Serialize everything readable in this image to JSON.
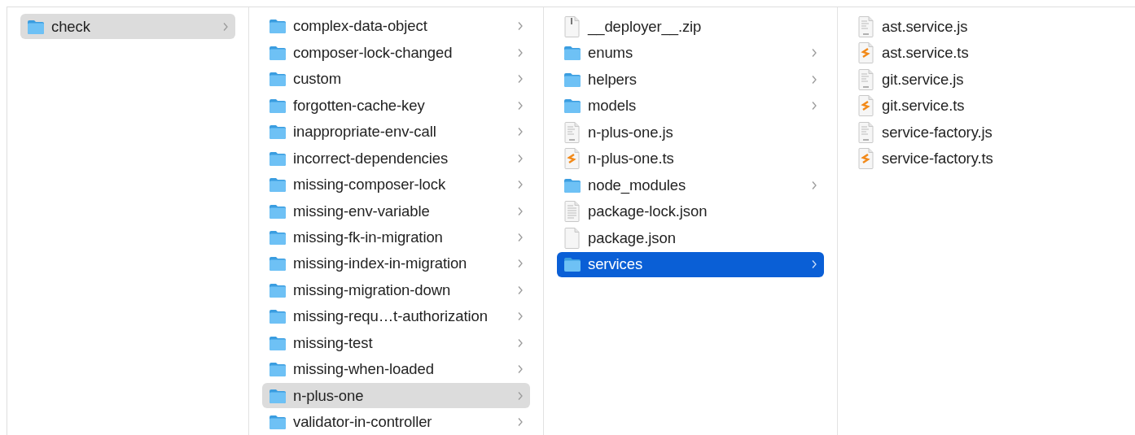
{
  "columns": [
    {
      "active": false,
      "items": [
        {
          "name": "check",
          "kind": "folder",
          "selected": true
        }
      ]
    },
    {
      "active": false,
      "items": [
        {
          "name": "complex-data-object",
          "kind": "folder",
          "selected": false
        },
        {
          "name": "composer-lock-changed",
          "kind": "folder",
          "selected": false
        },
        {
          "name": "custom",
          "kind": "folder",
          "selected": false
        },
        {
          "name": "forgotten-cache-key",
          "kind": "folder",
          "selected": false
        },
        {
          "name": "inappropriate-env-call",
          "kind": "folder",
          "selected": false
        },
        {
          "name": "incorrect-dependencies",
          "kind": "folder",
          "selected": false
        },
        {
          "name": "missing-composer-lock",
          "kind": "folder",
          "selected": false
        },
        {
          "name": "missing-env-variable",
          "kind": "folder",
          "selected": false
        },
        {
          "name": "missing-fk-in-migration",
          "kind": "folder",
          "selected": false
        },
        {
          "name": "missing-index-in-migration",
          "kind": "folder",
          "selected": false
        },
        {
          "name": "missing-migration-down",
          "kind": "folder",
          "selected": false
        },
        {
          "name": "missing-requ…t-authorization",
          "kind": "folder",
          "selected": false
        },
        {
          "name": "missing-test",
          "kind": "folder",
          "selected": false
        },
        {
          "name": "missing-when-loaded",
          "kind": "folder",
          "selected": false
        },
        {
          "name": "n-plus-one",
          "kind": "folder",
          "selected": true
        },
        {
          "name": "validator-in-controller",
          "kind": "folder",
          "selected": false
        }
      ]
    },
    {
      "active": true,
      "items": [
        {
          "name": "__deployer__.zip",
          "kind": "zip",
          "selected": false
        },
        {
          "name": "enums",
          "kind": "folder",
          "selected": false
        },
        {
          "name": "helpers",
          "kind": "folder",
          "selected": false
        },
        {
          "name": "models",
          "kind": "folder",
          "selected": false
        },
        {
          "name": "n-plus-one.js",
          "kind": "js",
          "selected": false
        },
        {
          "name": "n-plus-one.ts",
          "kind": "ts",
          "selected": false
        },
        {
          "name": "node_modules",
          "kind": "folder",
          "selected": false
        },
        {
          "name": "package-lock.json",
          "kind": "text",
          "selected": false
        },
        {
          "name": "package.json",
          "kind": "document",
          "selected": false
        },
        {
          "name": "services",
          "kind": "folder",
          "selected": true
        }
      ]
    },
    {
      "items": [
        {
          "name": "ast.service.js",
          "kind": "js",
          "selected": false
        },
        {
          "name": "ast.service.ts",
          "kind": "ts",
          "selected": false
        },
        {
          "name": "git.service.js",
          "kind": "js",
          "selected": false
        },
        {
          "name": "git.service.ts",
          "kind": "ts",
          "selected": false
        },
        {
          "name": "service-factory.js",
          "kind": "js",
          "selected": false
        },
        {
          "name": "service-factory.ts",
          "kind": "ts",
          "selected": false
        }
      ]
    }
  ]
}
